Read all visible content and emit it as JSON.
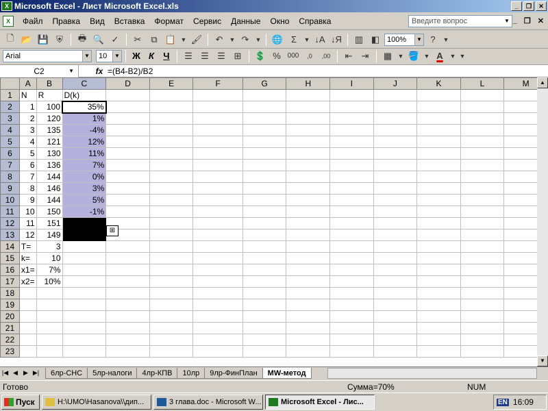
{
  "window": {
    "title": "Microsoft Excel - Лист Microsoft Excel.xls"
  },
  "menu": [
    "Файл",
    "Правка",
    "Вид",
    "Вставка",
    "Формат",
    "Сервис",
    "Данные",
    "Окно",
    "Справка"
  ],
  "help_placeholder": "Введите вопрос",
  "toolbar": {
    "zoom": "100%",
    "font": "Arial",
    "size": "10"
  },
  "formula_bar": {
    "name_box": "C2",
    "formula": "=(B4-B2)/B2"
  },
  "columns": [
    "A",
    "B",
    "C",
    "D",
    "E",
    "F",
    "G",
    "H",
    "I",
    "J",
    "K",
    "L",
    "M"
  ],
  "rows": [
    [
      "N",
      "R",
      "D(k)"
    ],
    [
      "1",
      "100",
      "35%"
    ],
    [
      "2",
      "120",
      "1%"
    ],
    [
      "3",
      "135",
      "-4%"
    ],
    [
      "4",
      "121",
      "12%"
    ],
    [
      "5",
      "130",
      "11%"
    ],
    [
      "6",
      "136",
      "7%"
    ],
    [
      "7",
      "144",
      "0%"
    ],
    [
      "8",
      "146",
      "3%"
    ],
    [
      "9",
      "144",
      "5%"
    ],
    [
      "10",
      "150",
      "-1%"
    ],
    [
      "11",
      "151",
      ""
    ],
    [
      "12",
      "149",
      ""
    ],
    [
      "T=",
      "3",
      ""
    ],
    [
      "k=",
      "10",
      ""
    ],
    [
      "x1=",
      "7%",
      ""
    ],
    [
      "x2=",
      "10%",
      ""
    ],
    [
      "",
      "",
      ""
    ],
    [
      "",
      "",
      ""
    ],
    [
      "",
      "",
      ""
    ],
    [
      "",
      "",
      ""
    ],
    [
      "",
      "",
      ""
    ],
    [
      "",
      "",
      ""
    ]
  ],
  "sheet_tabs": [
    "6лр-СНС",
    "5лр-налоги",
    "4лр-КПВ",
    "10лр",
    "9лр-ФинПлан",
    "MW-метод"
  ],
  "status": {
    "ready": "Готово",
    "sum": "Сумма=70%",
    "num": "NUM"
  },
  "taskbar": {
    "start": "Пуск",
    "tasks": [
      "H:\\UMO\\Hasanova\\\\дип...",
      "3 глава.doc - Microsoft W...",
      "Microsoft Excel - Лис..."
    ],
    "lang": "EN",
    "time": "16:09"
  }
}
